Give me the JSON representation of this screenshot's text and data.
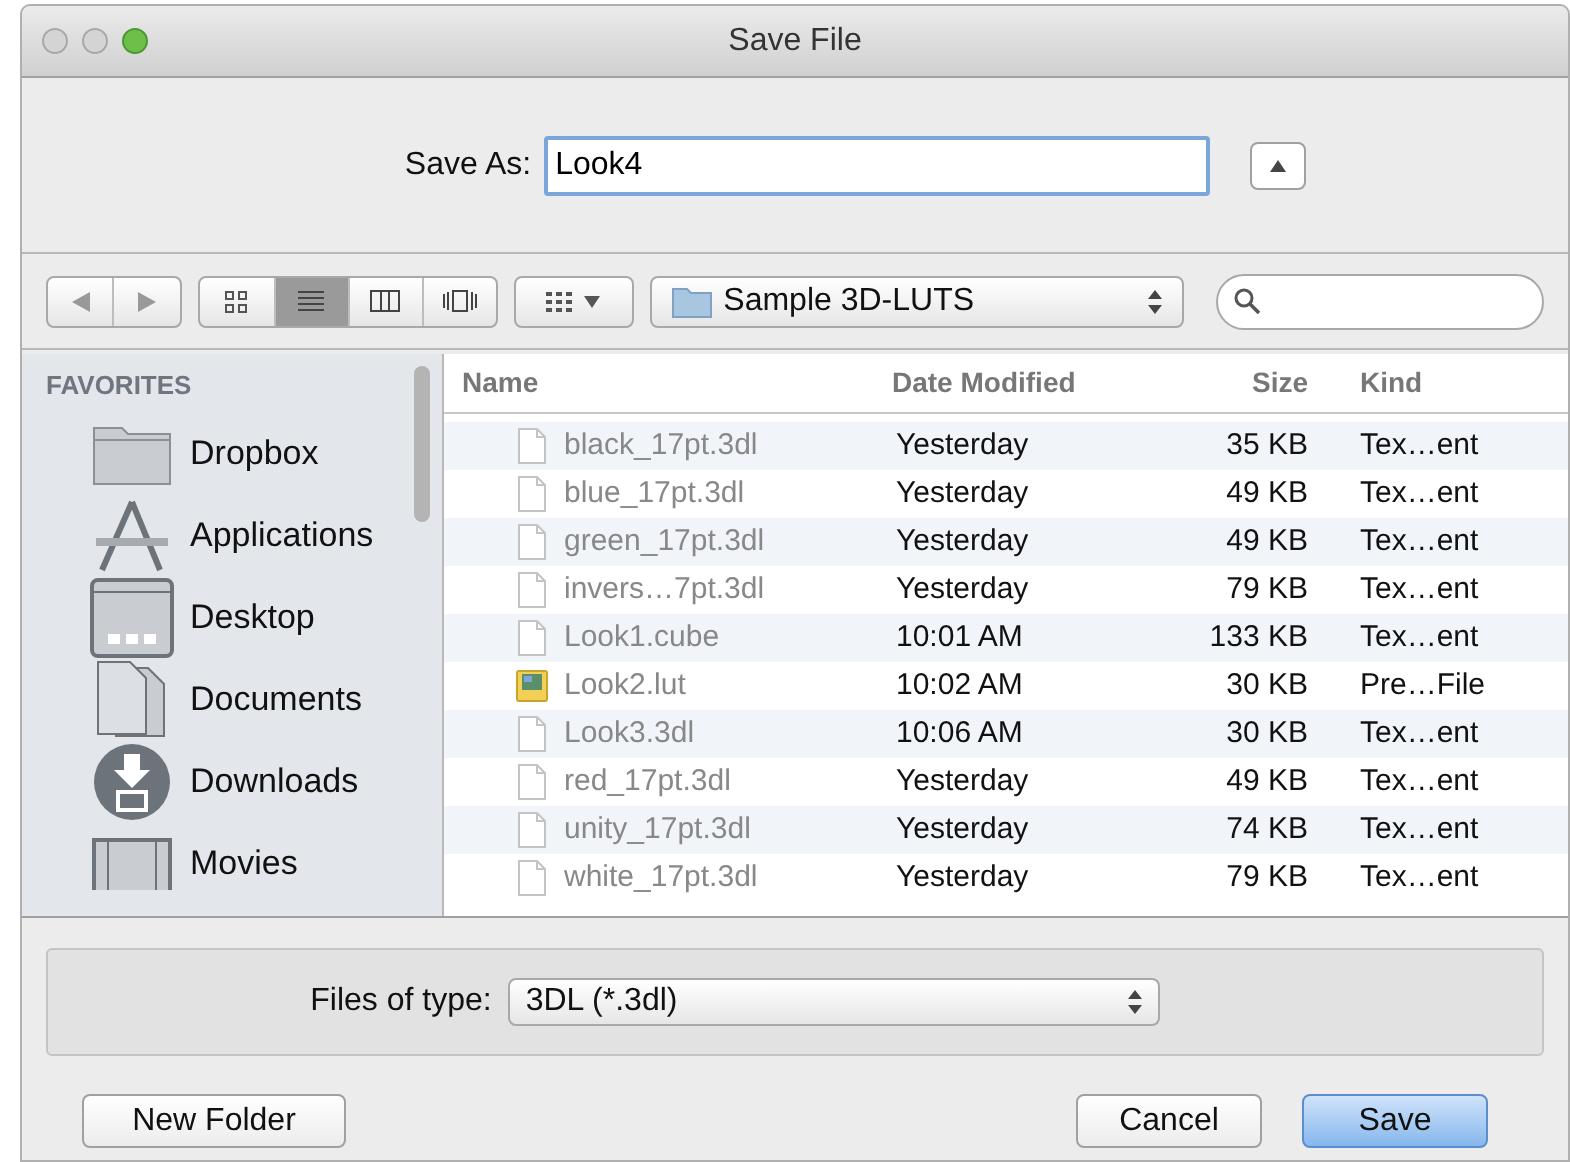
{
  "window": {
    "title": "Save File"
  },
  "save_as": {
    "label": "Save As:",
    "value": "Look4"
  },
  "toolbar": {
    "view_modes": [
      {
        "kind": "icons",
        "selected": false
      },
      {
        "kind": "list",
        "selected": true
      },
      {
        "kind": "columns",
        "selected": false
      },
      {
        "kind": "coverflow",
        "selected": false
      }
    ],
    "location": "Sample 3D-LUTS"
  },
  "sidebar": {
    "heading": "FAVORITES",
    "items": [
      {
        "kind": "folder",
        "label": "Dropbox"
      },
      {
        "kind": "applications",
        "label": "Applications"
      },
      {
        "kind": "desktop",
        "label": "Desktop"
      },
      {
        "kind": "documents",
        "label": "Documents"
      },
      {
        "kind": "downloads",
        "label": "Downloads"
      },
      {
        "kind": "movies",
        "label": "Movies"
      }
    ]
  },
  "table": {
    "columns": [
      "Name",
      "Date Modified",
      "Size",
      "Kind"
    ],
    "rows": [
      {
        "kind": "document",
        "name": "black_17pt.3dl",
        "date": "Yesterday",
        "size": "35 KB",
        "type": "Tex…ent"
      },
      {
        "kind": "document",
        "name": "blue_17pt.3dl",
        "date": "Yesterday",
        "size": "49 KB",
        "type": "Tex…ent"
      },
      {
        "kind": "document",
        "name": "green_17pt.3dl",
        "date": "Yesterday",
        "size": "49 KB",
        "type": "Tex…ent"
      },
      {
        "kind": "document",
        "name": "invers…7pt.3dl",
        "date": "Yesterday",
        "size": "79 KB",
        "type": "Tex…ent"
      },
      {
        "kind": "document",
        "name": "Look1.cube",
        "date": "10:01 AM",
        "size": "133 KB",
        "type": "Tex…ent"
      },
      {
        "kind": "image",
        "name": "Look2.lut",
        "date": "10:02 AM",
        "size": "30 KB",
        "type": "Pre…File"
      },
      {
        "kind": "document",
        "name": "Look3.3dl",
        "date": "10:06 AM",
        "size": "30 KB",
        "type": "Tex…ent"
      },
      {
        "kind": "document",
        "name": "red_17pt.3dl",
        "date": "Yesterday",
        "size": "49 KB",
        "type": "Tex…ent"
      },
      {
        "kind": "document",
        "name": "unity_17pt.3dl",
        "date": "Yesterday",
        "size": "74 KB",
        "type": "Tex…ent"
      },
      {
        "kind": "document",
        "name": "white_17pt.3dl",
        "date": "Yesterday",
        "size": "79 KB",
        "type": "Tex…ent"
      }
    ]
  },
  "file_type": {
    "label": "Files of type:",
    "value": "3DL (*.3dl)"
  },
  "buttons": {
    "new_folder": "New Folder",
    "cancel": "Cancel",
    "save": "Save"
  }
}
